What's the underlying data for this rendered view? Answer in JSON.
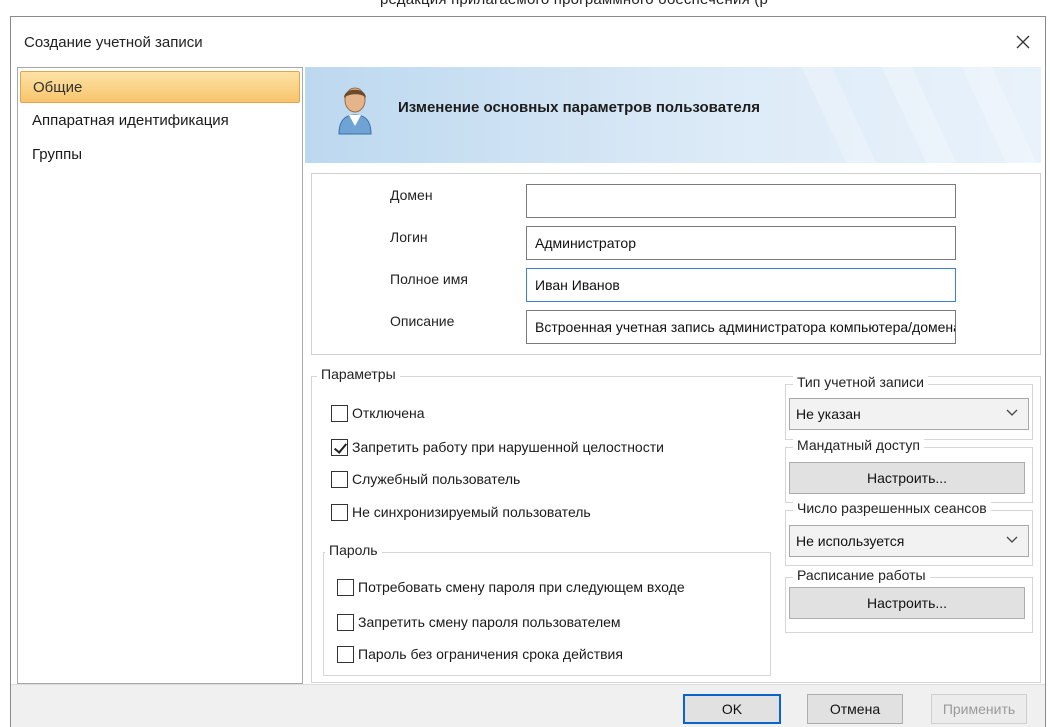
{
  "cropped_text": "редакция прилагаемого программного обеспечения (р",
  "window": {
    "title": "Создание учетной записи"
  },
  "sidebar": {
    "items": [
      {
        "label": "Общие",
        "active": true
      },
      {
        "label": "Аппаратная идентификация",
        "active": false
      },
      {
        "label": "Группы",
        "active": false
      }
    ]
  },
  "banner": {
    "title": "Изменение основных параметров пользователя",
    "icon": "user-icon"
  },
  "fields": {
    "domain": {
      "label": "Домен",
      "value": ""
    },
    "login": {
      "label": "Логин",
      "value": "Администратор"
    },
    "fullname": {
      "label": "Полное имя",
      "value": "Иван Иванов"
    },
    "description": {
      "label": "Описание",
      "value": "Встроенная учетная запись администратора компьютера/домена"
    }
  },
  "params": {
    "legend": "Параметры",
    "disabled": {
      "label": "Отключена",
      "checked": false
    },
    "integrity": {
      "label": "Запретить работу при нарушенной целостности",
      "checked": true
    },
    "service": {
      "label": "Служебный пользователь",
      "checked": false
    },
    "nosync": {
      "label": "Не синхронизируемый пользователь",
      "checked": false
    }
  },
  "password": {
    "legend": "Пароль",
    "require_change": {
      "label": "Потребовать смену пароля при следующем входе",
      "checked": false
    },
    "forbid_change": {
      "label": "Запретить смену пароля пользователем",
      "checked": false
    },
    "no_expiry": {
      "label": "Пароль без ограничения срока действия",
      "checked": false
    }
  },
  "account_type": {
    "legend": "Тип учетной записи",
    "value": "Не указан"
  },
  "mandatory_access": {
    "legend": "Мандатный доступ",
    "button": "Настроить..."
  },
  "sessions": {
    "legend": "Число разрешенных сеансов",
    "value": "Не используется"
  },
  "schedule": {
    "legend": "Расписание работы",
    "button": "Настроить..."
  },
  "footer": {
    "ok": "OK",
    "cancel": "Отмена",
    "apply": "Применить"
  },
  "colors": {
    "active_nav": "#f7c46d",
    "banner": "#bcd8ef",
    "focus_border": "#3d7fd1",
    "ok_border": "#0a64c8"
  }
}
